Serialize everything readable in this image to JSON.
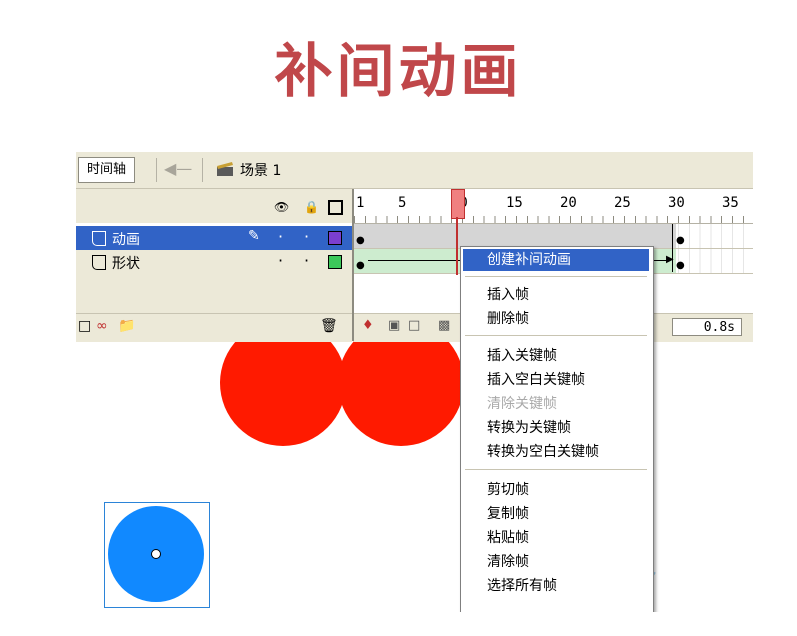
{
  "slide": {
    "title": "补间动画"
  },
  "topbar": {
    "timeline_button": "时间轴",
    "back_icon": "arrow-left-icon",
    "scene_label": "场景 1"
  },
  "layers": {
    "header_icons": [
      "eye-icon",
      "lock-icon",
      "outline-icon"
    ],
    "rows": [
      {
        "name": "动画",
        "selected": true,
        "color": "#7b3fcf"
      },
      {
        "name": "形状",
        "selected": false,
        "color": "#3cc85a"
      }
    ],
    "footer_icons": [
      "insert-layer-icon",
      "add-motion-guide-icon",
      "insert-folder-icon",
      "delete-layer-icon"
    ]
  },
  "timeline": {
    "ruler": [
      "1",
      "5",
      "10",
      "15",
      "20",
      "25",
      "30",
      "35"
    ],
    "current_frame": 10,
    "footer_icons": [
      "center-frame-icon",
      "onion-skin-icon",
      "onion-outline-icon",
      "edit-multiple-icon"
    ],
    "elapsed_time": "0.8s"
  },
  "context_menu": {
    "items": [
      {
        "label": "创建补间动画",
        "state": "highlighted"
      },
      {
        "separator": true
      },
      {
        "label": "插入帧",
        "state": "normal"
      },
      {
        "label": "删除帧",
        "state": "normal"
      },
      {
        "separator": true
      },
      {
        "label": "插入关键帧",
        "state": "normal"
      },
      {
        "label": "插入空白关键帧",
        "state": "normal"
      },
      {
        "label": "清除关键帧",
        "state": "disabled"
      },
      {
        "label": "转换为关键帧",
        "state": "normal"
      },
      {
        "label": "转换为空白关键帧",
        "state": "normal"
      },
      {
        "separator": true
      },
      {
        "label": "剪切帧",
        "state": "normal"
      },
      {
        "label": "复制帧",
        "state": "normal"
      },
      {
        "label": "粘贴帧",
        "state": "normal"
      },
      {
        "label": "清除帧",
        "state": "normal"
      },
      {
        "label": "选择所有帧",
        "state": "normal"
      }
    ]
  },
  "stage": {
    "shapes": [
      {
        "name": "red-circle",
        "color": "#ff1a00"
      },
      {
        "name": "red-circle",
        "color": "#ff1a00"
      },
      {
        "name": "blue-circle",
        "color": "#1189ff"
      }
    ]
  },
  "colors": {
    "title": "#c0474a",
    "selection": "#3163c6",
    "panel": "#ece9d8"
  }
}
